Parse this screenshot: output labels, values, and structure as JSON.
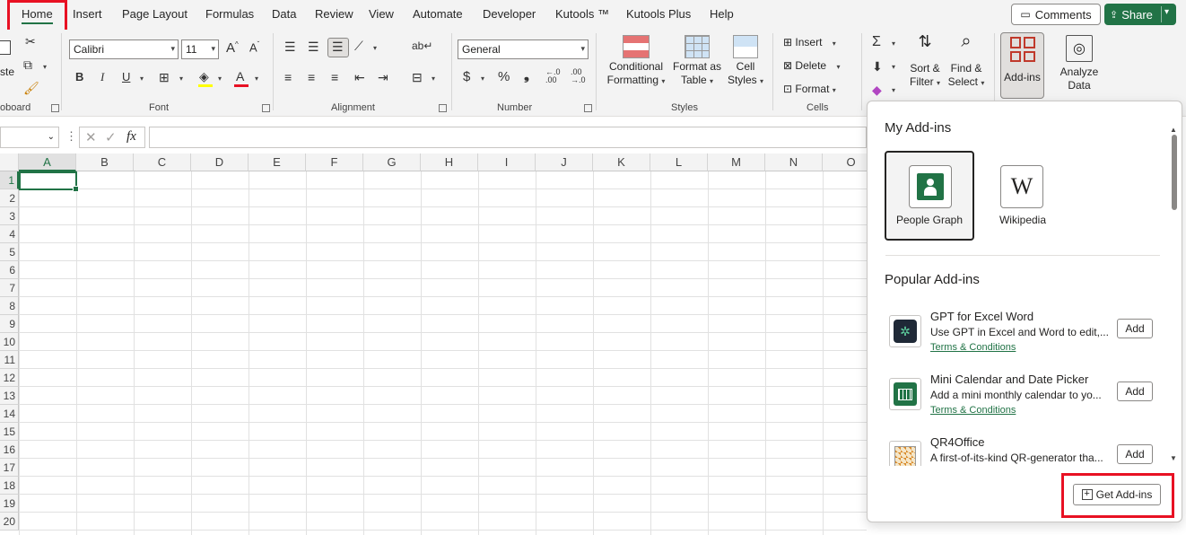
{
  "menu": {
    "tabs": [
      "Home",
      "Insert",
      "Page Layout",
      "Formulas",
      "Data",
      "Review",
      "View",
      "Automate",
      "Developer",
      "Kutools ™",
      "Kutools Plus",
      "Help"
    ],
    "comments_label": "Comments",
    "share_label": "Share"
  },
  "ribbon": {
    "clipboard": {
      "paste_fragment": "ste",
      "group_label": "oboard"
    },
    "font": {
      "name": "Calibri",
      "size": "11",
      "group_label": "Font",
      "bold": "B",
      "italic": "I",
      "underline": "U",
      "grow": "A",
      "shrink": "A",
      "font_color": "A"
    },
    "alignment": {
      "group_label": "Alignment"
    },
    "number": {
      "format": "General",
      "group_label": "Number",
      "currency": "$",
      "percent": "%",
      "comma": "❟",
      "inc_decimal": "←.0\n.00",
      "dec_decimal": ".00\n→.0"
    },
    "styles": {
      "group_label": "Styles",
      "conditional": [
        "Conditional",
        "Formatting"
      ],
      "format_table": [
        "Format as",
        "Table"
      ],
      "cell_styles": [
        "Cell",
        "Styles"
      ]
    },
    "cells": {
      "group_label": "Cells",
      "insert": "Insert",
      "delete": "Delete",
      "format": "Format"
    },
    "editing": {
      "sort": [
        "Sort &",
        "Filter"
      ],
      "find": [
        "Find &",
        "Select"
      ]
    },
    "addins": {
      "label": "Add-ins"
    },
    "analyze": {
      "label": [
        "Analyze",
        "Data"
      ]
    }
  },
  "formula_bar": {
    "fx": "fx"
  },
  "grid": {
    "columns": [
      "A",
      "B",
      "C",
      "D",
      "E",
      "F",
      "G",
      "H",
      "I",
      "J",
      "K",
      "L",
      "M",
      "N",
      "O"
    ],
    "rows": [
      "1",
      "2",
      "3",
      "4",
      "5",
      "6",
      "7",
      "8",
      "9",
      "10",
      "11",
      "12",
      "13",
      "14",
      "15",
      "16",
      "17",
      "18",
      "19",
      "20"
    ]
  },
  "panel": {
    "my_addins_title": "My Add-ins",
    "my_addins": [
      {
        "name": "People Graph",
        "icon": "people-graph-icon"
      },
      {
        "name": "Wikipedia",
        "icon": "wikipedia-icon",
        "glyph": "W"
      }
    ],
    "popular_title": "Popular Add-ins",
    "popular": [
      {
        "title": "GPT for Excel Word",
        "desc": "Use GPT in Excel and Word to edit,...",
        "terms": "Terms & Conditions",
        "add": "Add",
        "icon": "gpt-icon"
      },
      {
        "title": "Mini Calendar and Date Picker",
        "desc": "Add a mini monthly calendar to yo...",
        "terms": "Terms & Conditions",
        "add": "Add",
        "icon": "calendar-icon"
      },
      {
        "title": "QR4Office",
        "desc": "A first-of-its-kind QR-generator tha...",
        "terms": "",
        "add": "Add",
        "icon": "qr-icon"
      }
    ],
    "get_addins_label": "Get Add-ins"
  },
  "colors": {
    "accent": "#217346",
    "highlight": "#e81123"
  }
}
